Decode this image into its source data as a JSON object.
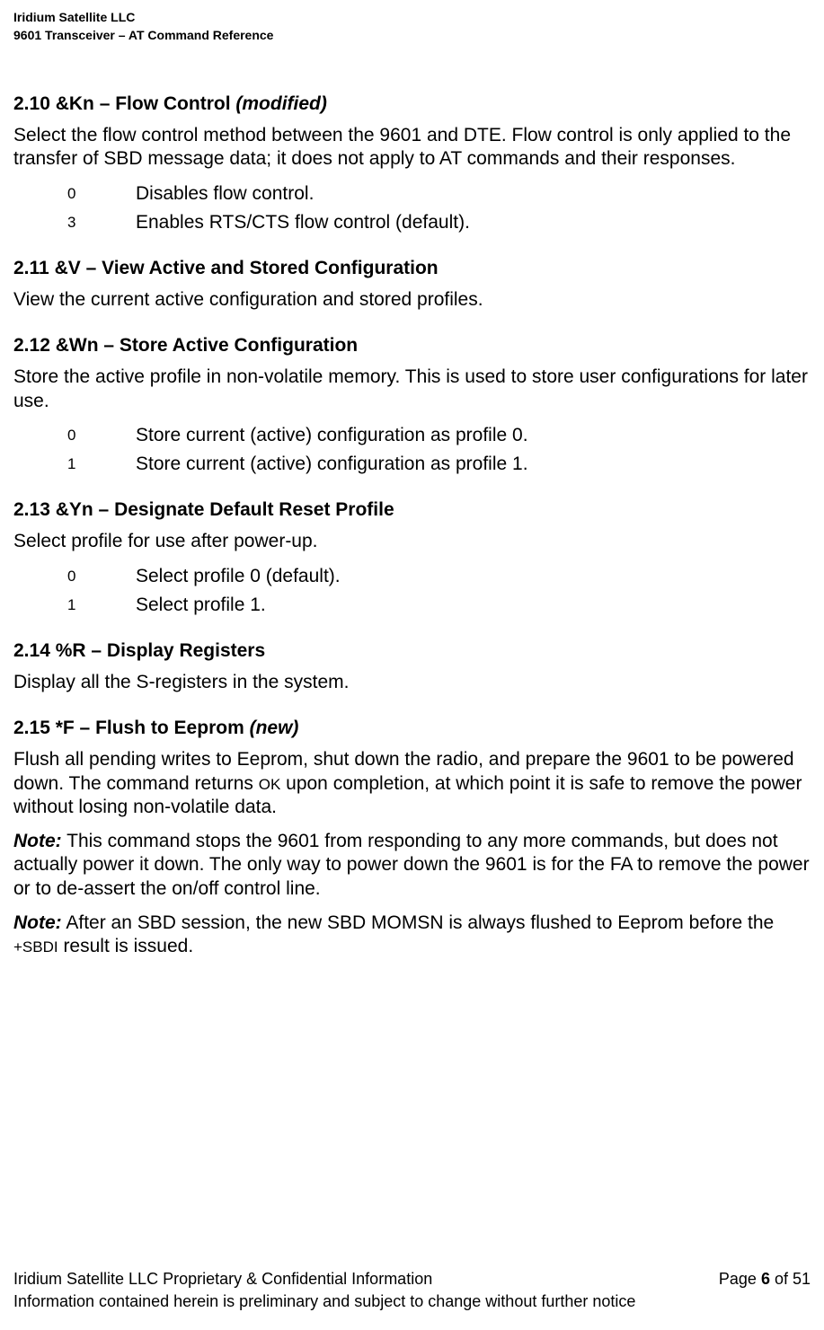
{
  "header": {
    "company": "Iridium Satellite LLC",
    "product": "9601 Transceiver – AT Command Reference"
  },
  "sections": {
    "s210": {
      "num": "2.10",
      "title": "&Kn – Flow Control ",
      "suffix": "(modified)",
      "body": "Select the flow control method between the 9601 and DTE.  Flow control is only applied to the transfer of SBD message data; it does not apply to AT commands and their responses.",
      "params": [
        {
          "key": "0",
          "desc": "Disables flow control."
        },
        {
          "key": "3",
          "desc": "Enables RTS/CTS flow control (default)."
        }
      ]
    },
    "s211": {
      "num": "2.11",
      "title": "&V – View Active and Stored Configuration",
      "body": "View the current active configuration and stored profiles."
    },
    "s212": {
      "num": "2.12",
      "title": "&Wn – Store Active Configuration",
      "body": "Store the active profile in non-volatile memory. This is used to store user configurations for later use.",
      "params": [
        {
          "key": "0",
          "desc": "Store current (active) configuration as profile 0."
        },
        {
          "key": "1",
          "desc": "Store current (active) configuration as profile 1."
        }
      ]
    },
    "s213": {
      "num": "2.13",
      "title": "&Yn – Designate Default Reset Profile",
      "body": "Select profile for use after power-up.",
      "params": [
        {
          "key": "0",
          "desc": "Select profile 0 (default)."
        },
        {
          "key": "1",
          "desc": "Select profile 1."
        }
      ]
    },
    "s214": {
      "num": "2.14",
      "title": "%R – Display Registers",
      "body": "Display all the S-registers in the system."
    },
    "s215": {
      "num": "2.15",
      "title": "*F – Flush to Eeprom ",
      "suffix": "(new)",
      "body_pre": "Flush all pending writes to Eeprom, shut down the radio, and prepare the 9601 to be powered down.  The command returns ",
      "body_ok": "OK",
      "body_post": " upon completion, at which point it is safe to remove the power without losing non-volatile data.",
      "note1_label": "Note:",
      "note1": "  This command stops the 9601 from responding to any more commands, but does not actually power it down.  The only way to power down the 9601 is for the FA to remove the power or to de-assert the on/off control line.",
      "note2_label": "Note:",
      "note2_pre": " After an SBD session, the new SBD MOMSN is always flushed to Eeprom before the ",
      "note2_cmd": "+SBDI",
      "note2_post": " result is issued."
    }
  },
  "footer": {
    "left": "Iridium Satellite LLC Proprietary & Confidential Information",
    "page_label": "Page ",
    "page_num": "6",
    "page_of": " of 51",
    "line2": "Information contained herein is preliminary and subject to change without further notice"
  }
}
